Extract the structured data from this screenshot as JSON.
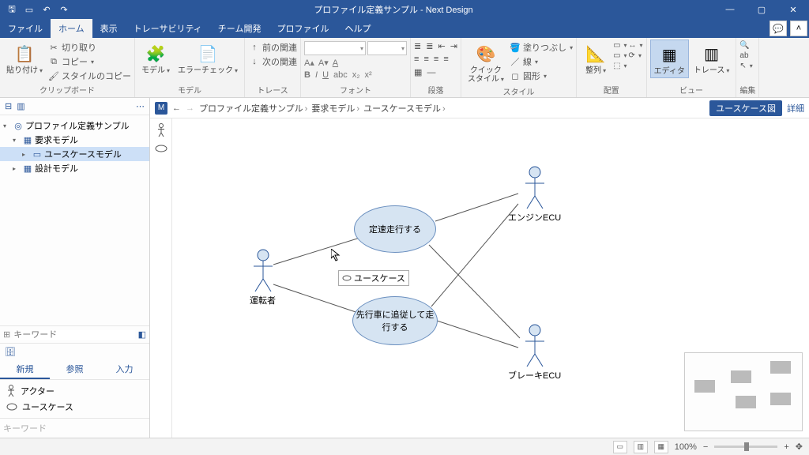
{
  "title": "プロファイル定義サンプル - Next Design",
  "tabs": [
    "ファイル",
    "ホーム",
    "表示",
    "トレーサビリティ",
    "チーム開発",
    "プロファイル",
    "ヘルプ"
  ],
  "activeTab": 1,
  "ribbon": {
    "clipboard": {
      "paste": "貼り付け",
      "cut": "切り取り",
      "copy": "コピー",
      "stylecopy": "スタイルのコピー",
      "label": "クリップボード"
    },
    "model": {
      "model": "モデル",
      "errcheck": "エラーチェック",
      "label": "モデル"
    },
    "trace": {
      "prev": "前の関連",
      "next": "次の関連",
      "label": "トレース"
    },
    "font": {
      "label": "フォント"
    },
    "para": {
      "label": "段落"
    },
    "style": {
      "quick": "クイック\nスタイル",
      "fill": "塗りつぶし",
      "line": "線",
      "shape": "図形",
      "label": "スタイル"
    },
    "arrange": {
      "align": "整列",
      "label": "配置"
    },
    "view": {
      "editor": "エディタ",
      "trace": "トレース",
      "label": "ビュー"
    },
    "edit": {
      "label": "編集"
    }
  },
  "tree": {
    "root": "プロファイル定義サンプル",
    "req": "要求モデル",
    "usecase": "ユースケースモデル",
    "design": "設計モデル"
  },
  "searchPh": "キーワード",
  "bottomTabs": [
    "新規",
    "参照",
    "入力"
  ],
  "palette": {
    "actor": "アクター",
    "usecase": "ユースケース"
  },
  "crumb": {
    "p1": "プロファイル定義サンプル",
    "p2": "要求モデル",
    "p3": "ユースケースモデル",
    "view": "ユースケース図",
    "detail": "詳細"
  },
  "diagram": {
    "actor1": "運転者",
    "actor2": "エンジンECU",
    "actor3": "ブレーキECU",
    "uc1": "定速走行する",
    "uc2": "先行車に追従して走\n行する",
    "tooltip": "ユースケース"
  },
  "status": {
    "zoom": "100%"
  },
  "kwPh": "キーワード"
}
